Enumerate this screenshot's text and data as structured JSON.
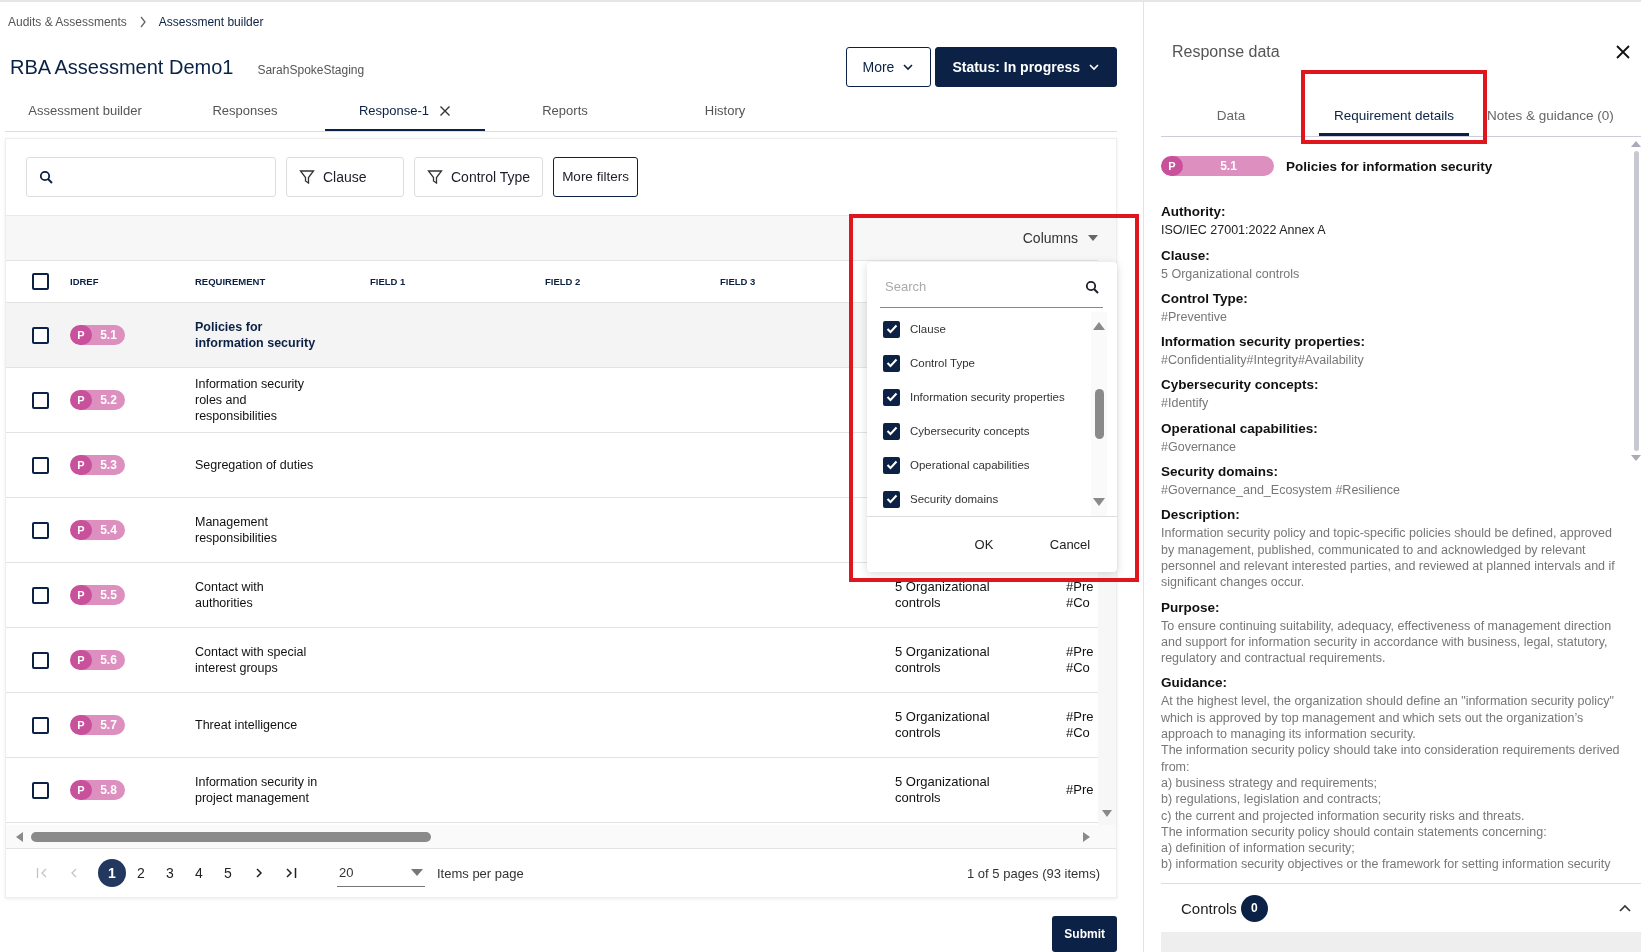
{
  "breadcrumb": [
    {
      "label": "Audits & Assessments",
      "current": false
    },
    {
      "label": "Assessment builder",
      "current": true
    }
  ],
  "title": "RBA Assessment Demo1",
  "subtitle": "SarahSpokeStaging",
  "header_buttons": [
    {
      "label": "More",
      "kind": "outline"
    },
    {
      "label": "Status: In progress",
      "kind": "primary"
    }
  ],
  "tabs": [
    {
      "label": "Assessment builder",
      "selected": false,
      "closable": false
    },
    {
      "label": "Responses",
      "selected": false,
      "closable": false
    },
    {
      "label": "Response-1",
      "selected": true,
      "closable": true
    },
    {
      "label": "Reports",
      "selected": false,
      "closable": false
    },
    {
      "label": "History",
      "selected": false,
      "closable": false
    }
  ],
  "filter_buttons": [
    {
      "label": "Clause",
      "kind": "filter"
    },
    {
      "label": "Control Type",
      "kind": "filter"
    },
    {
      "label": "More filters",
      "kind": "outline"
    }
  ],
  "columns_menu": {
    "label": "Columns",
    "highlighted": true,
    "search_placeholder": "Search",
    "items": [
      {
        "label": "Clause",
        "checked": true
      },
      {
        "label": "Control Type",
        "checked": true
      },
      {
        "label": "Information security properties",
        "checked": true
      },
      {
        "label": "Cybersecurity concepts",
        "checked": true
      },
      {
        "label": "Operational capabilities",
        "checked": true
      },
      {
        "label": "Security domains",
        "checked": true
      }
    ],
    "buttons": [
      "OK",
      "Cancel"
    ]
  },
  "table": {
    "select_all_checked": false,
    "columns": [
      "IDREF",
      "REQUIREMENT",
      "FIELD 1",
      "FIELD 2",
      "FIELD 3"
    ],
    "rows": [
      {
        "prefix": "P",
        "idref": "5.1",
        "requirement": "Policies for information security",
        "checked": false,
        "selected": true
      },
      {
        "prefix": "P",
        "idref": "5.2",
        "requirement": "Information security roles and responsibilities",
        "checked": false,
        "selected": false
      },
      {
        "prefix": "P",
        "idref": "5.3",
        "requirement": "Segregation of duties",
        "checked": false,
        "selected": false
      },
      {
        "prefix": "P",
        "idref": "5.4",
        "requirement": "Management responsibilities",
        "checked": false,
        "selected": false
      },
      {
        "prefix": "P",
        "idref": "5.5",
        "requirement": "Contact with authorities",
        "checked": false,
        "selected": false,
        "clause": "5 Organizational controls",
        "control_type": [
          "#Pre",
          "#Co"
        ]
      },
      {
        "prefix": "P",
        "idref": "5.6",
        "requirement": "Contact with special interest groups",
        "checked": false,
        "selected": false,
        "clause": "5 Organizational controls",
        "control_type": [
          "#Pre",
          "#Co"
        ]
      },
      {
        "prefix": "P",
        "idref": "5.7",
        "requirement": "Threat intelligence",
        "checked": false,
        "selected": false,
        "clause": "5 Organizational controls",
        "control_type": [
          "#Pre",
          "#Co"
        ]
      },
      {
        "prefix": "P",
        "idref": "5.8",
        "requirement": "Information security in project management",
        "checked": false,
        "selected": false,
        "clause": "5 Organizational controls",
        "control_type": [
          "#Pre"
        ]
      }
    ]
  },
  "pagination": {
    "first_disabled": true,
    "prev_disabled": true,
    "pages": [
      {
        "label": "1",
        "selected": true
      },
      {
        "label": "2",
        "selected": false
      },
      {
        "label": "3",
        "selected": false
      },
      {
        "label": "4",
        "selected": false
      },
      {
        "label": "5",
        "selected": false
      }
    ],
    "items_per_page": "20",
    "items_per_page_label": "Items per page",
    "summary": "1 of 5 pages (93 items)"
  },
  "submit": "Submit",
  "panel": {
    "title": "Response data",
    "tabs": [
      {
        "label": "Data",
        "selected": false,
        "highlighted": false
      },
      {
        "label": "Requirement details",
        "selected": true,
        "highlighted": true
      },
      {
        "label": "Notes & guidance (0)",
        "selected": false,
        "highlighted": false
      }
    ],
    "requirement": {
      "prefix": "P",
      "idref": "5.1",
      "title": "Policies for information security"
    },
    "fields": [
      {
        "label": "Authority:",
        "muted": false,
        "lines": [
          "ISO/IEC 27001:2022 Annex A"
        ]
      },
      {
        "label": "Clause:",
        "muted": true,
        "lines": [
          "5 Organizational controls"
        ]
      },
      {
        "label": "Control Type:",
        "muted": true,
        "lines": [
          "#Preventive"
        ]
      },
      {
        "label": "Information security properties:",
        "muted": true,
        "lines": [
          "#Confidentiality#Integrity#Availability"
        ]
      },
      {
        "label": "Cybersecurity concepts:",
        "muted": true,
        "lines": [
          "#Identify"
        ]
      },
      {
        "label": "Operational capabilities:",
        "muted": true,
        "lines": [
          "#Governance"
        ]
      },
      {
        "label": "Security domains:",
        "muted": true,
        "lines": [
          "#Governance_and_Ecosystem #Resilience"
        ]
      },
      {
        "label": "Description:",
        "muted": true,
        "lines": [
          "Information security policy and topic-specific policies should be defined, approved by management, published, communicated to and acknowledged by relevant personnel and relevant interested parties, and reviewed at planned intervals and if significant changes occur."
        ]
      },
      {
        "label": "Purpose:",
        "muted": true,
        "lines": [
          "To ensure continuing suitability, adequacy, effectiveness of management direction and support for information security in accordance with business, legal, statutory, regulatory and contractual requirements."
        ]
      },
      {
        "label": "Guidance:",
        "muted": true,
        "lines": [
          "At the highest level, the organization should define an \"information security policy\" which is approved by top management and which sets out the organization’s approach to managing its information security.",
          "The information security policy should take into consideration requirements derived from:",
          "a) business strategy and requirements;",
          "b) regulations, legislation and contracts;",
          "c) the current and projected information security risks and threats.",
          "The information security policy should contain statements concerning:",
          "a) definition of information security;",
          "b) information security objectives or the framework for setting information security"
        ]
      }
    ],
    "controls": {
      "label": "Controls",
      "count": "0",
      "expanded": true
    }
  }
}
